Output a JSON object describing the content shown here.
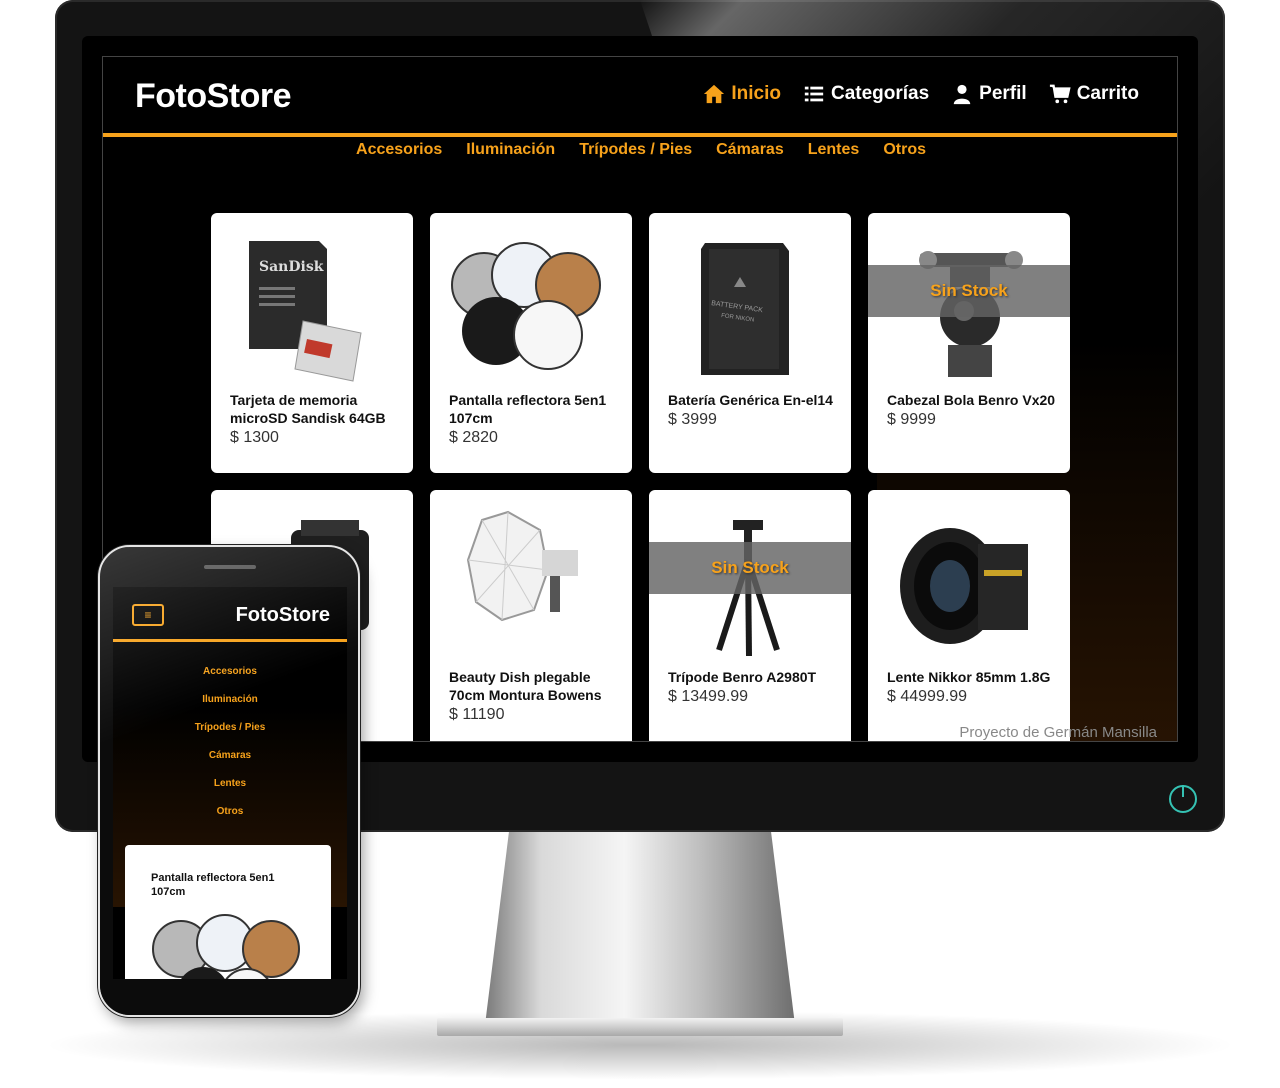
{
  "site": {
    "title": "FotoStore"
  },
  "nav": {
    "items": [
      {
        "label": "Inicio",
        "icon": "home-icon",
        "active": true
      },
      {
        "label": "Categorías",
        "icon": "list-icon",
        "active": false
      },
      {
        "label": "Perfil",
        "icon": "user-icon",
        "active": false
      },
      {
        "label": "Carrito",
        "icon": "cart-icon",
        "active": false
      }
    ]
  },
  "categories": [
    "Accesorios",
    "Iluminación",
    "Trípodes / Pies",
    "Cámaras",
    "Lentes",
    "Otros"
  ],
  "products": [
    {
      "name": "Tarjeta de memoria microSD Sandisk 64GB",
      "price": "$ 1300",
      "out_of_stock": false,
      "image": "sd-card"
    },
    {
      "name": "Pantalla reflectora 5en1 107cm",
      "price": "$ 2820",
      "out_of_stock": false,
      "image": "reflector"
    },
    {
      "name": "Batería Genérica En-el14",
      "price": "$ 3999",
      "out_of_stock": false,
      "image": "battery"
    },
    {
      "name": "Cabezal Bola Benro Vx20",
      "price": "$ 9999",
      "out_of_stock": true,
      "image": "ball-head"
    },
    {
      "name": "",
      "price": "",
      "out_of_stock": false,
      "image": "flash"
    },
    {
      "name": "Beauty Dish plegable 70cm Montura Bowens",
      "price": "$ 11190",
      "out_of_stock": false,
      "image": "beauty-dish"
    },
    {
      "name": "Trípode Benro A2980T",
      "price": "$ 13499.99",
      "out_of_stock": true,
      "image": "tripod"
    },
    {
      "name": "Lente Nikkor 85mm 1.8G",
      "price": "$ 44999.99",
      "out_of_stock": false,
      "image": "lens"
    }
  ],
  "out_of_stock_label": "Sin Stock",
  "footer": {
    "credit": "Proyecto de Germán Mansilla"
  },
  "mobile": {
    "title": "FotoStore",
    "menu_icon": "hamburger-icon",
    "menu": [
      "Accesorios",
      "Iluminación",
      "Trípodes / Pies",
      "Cámaras",
      "Lentes",
      "Otros"
    ],
    "card_name": "Pantalla reflectora 5en1 107cm"
  },
  "colors": {
    "accent": "#f7a21b",
    "background": "#000000",
    "card": "#ffffff",
    "power_led": "#35c2b3"
  }
}
